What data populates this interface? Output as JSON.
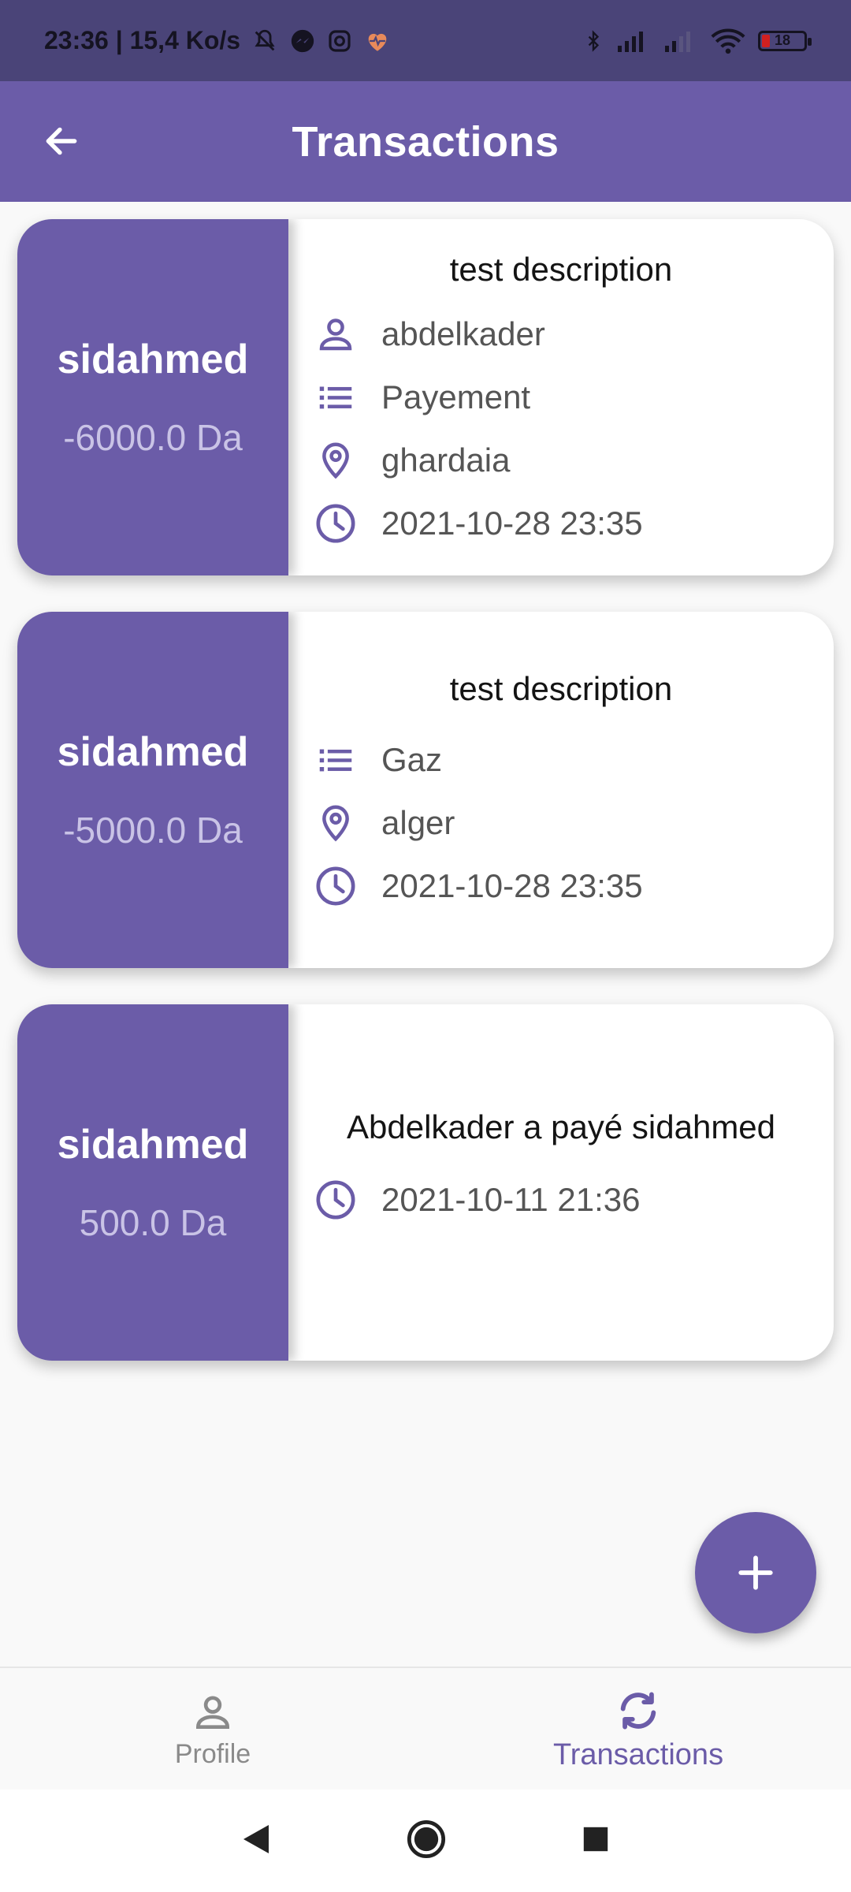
{
  "status_bar": {
    "time_speed": "23:36 | 15,4 Ko/s",
    "battery": "18"
  },
  "appbar": {
    "title": "Transactions"
  },
  "transactions": [
    {
      "name": "sidahmed",
      "amount": "-6000.0 Da",
      "description": "test description",
      "person": "abdelkader",
      "category": "Payement",
      "location": "ghardaia",
      "datetime": "2021-10-28 23:35"
    },
    {
      "name": "sidahmed",
      "amount": "-5000.0 Da",
      "description": "test description",
      "category": "Gaz",
      "location": "alger",
      "datetime": "2021-10-28 23:35"
    },
    {
      "name": "sidahmed",
      "amount": "500.0 Da",
      "description": "Abdelkader a payé sidahmed",
      "datetime": "2021-10-11 21:36"
    }
  ],
  "bottom_nav": {
    "profile": "Profile",
    "transactions": "Transactions"
  },
  "colors": {
    "primary": "#6b5ca8",
    "status_bar": "#4a4478"
  }
}
